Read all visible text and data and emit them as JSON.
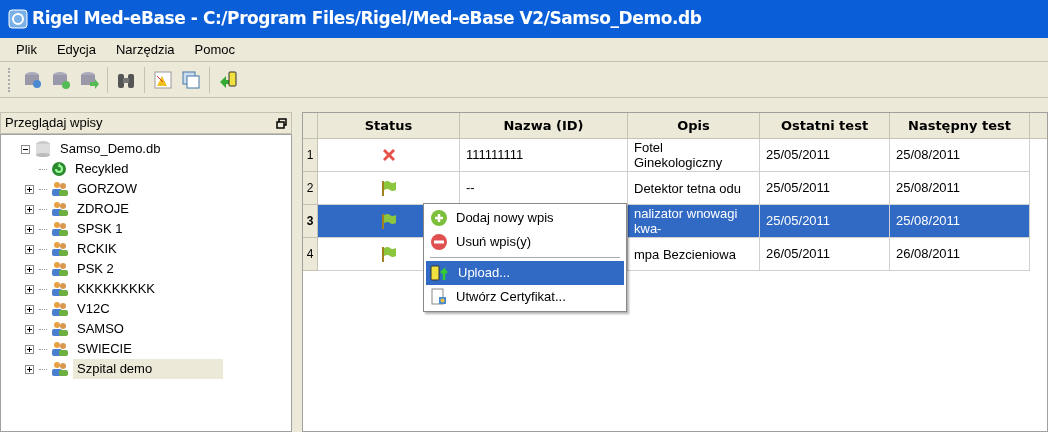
{
  "window": {
    "title": "Rigel Med-eBase - C:/Program Files/Rigel/Med-eBase V2/Samso_Demo.db"
  },
  "menu_bar": [
    "Plik",
    "Edycja",
    "Narzędzia",
    "Pomoc"
  ],
  "browser": {
    "title": "Przeglądaj wpisy",
    "root": {
      "label": "Samso_Demo.db",
      "expanded": true,
      "children": [
        {
          "label": "Recykled",
          "kind": "recycle",
          "selected": false
        },
        {
          "label": "GORZOW",
          "kind": "group",
          "expanded": false,
          "selected": false
        },
        {
          "label": "ZDROJE",
          "kind": "group",
          "expanded": false,
          "selected": false
        },
        {
          "label": "SPSK 1",
          "kind": "group",
          "expanded": false,
          "selected": false
        },
        {
          "label": "RCKIK",
          "kind": "group",
          "expanded": false,
          "selected": false
        },
        {
          "label": "PSK 2",
          "kind": "group",
          "expanded": false,
          "selected": false
        },
        {
          "label": "KKKKKKKKK",
          "kind": "group",
          "expanded": false,
          "selected": false
        },
        {
          "label": "V12C",
          "kind": "group",
          "expanded": false,
          "selected": false
        },
        {
          "label": "SAMSO",
          "kind": "group",
          "expanded": false,
          "selected": false
        },
        {
          "label": "SWIECIE",
          "kind": "group",
          "expanded": false,
          "selected": false
        },
        {
          "label": "Szpital demo",
          "kind": "group",
          "expanded": false,
          "selected": true
        }
      ]
    }
  },
  "table": {
    "columns": [
      "Status",
      "Nazwa (ID)",
      "Opis",
      "Ostatni test",
      "Następny test"
    ],
    "rows": [
      {
        "number": "1",
        "passed": false,
        "name": "111111111",
        "description": "Fotel Ginekologiczny",
        "last_test": "25/05/2011",
        "next_test": "25/08/2011",
        "selected": false
      },
      {
        "number": "2",
        "passed": true,
        "name": "--",
        "description": "Detektor tetna odu",
        "last_test": "25/05/2011",
        "next_test": "25/08/2011",
        "selected": false
      },
      {
        "number": "3",
        "passed": true,
        "description": "nalizator wnowagi kwa-",
        "last_test": "25/05/2011",
        "next_test": "25/08/2011",
        "selected": true
      },
      {
        "number": "4",
        "passed": true,
        "description": "mpa Bezcieniowa",
        "last_test": "26/05/2011",
        "next_test": "26/08/2011",
        "selected": false
      }
    ]
  },
  "context_menu": [
    {
      "kind": "add",
      "label": "Dodaj nowy wpis",
      "selected": false
    },
    {
      "kind": "remove",
      "label": "Usuń wpis(y)",
      "selected": false
    },
    {
      "kind": "separator"
    },
    {
      "kind": "upload",
      "label": "Upload...",
      "selected": true
    },
    {
      "kind": "certificate",
      "label": "Utwórz Certyfikat...",
      "selected": false
    }
  ]
}
